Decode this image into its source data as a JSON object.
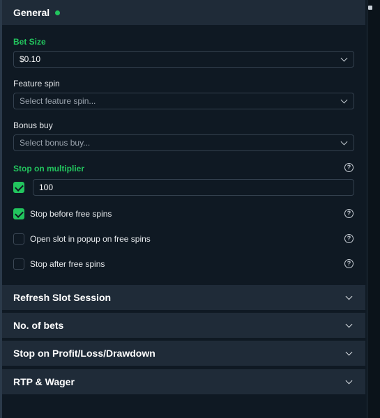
{
  "general": {
    "title": "General",
    "status_color": "#22c55e",
    "bet_size": {
      "label": "Bet Size",
      "value": "$0.10"
    },
    "feature_spin": {
      "label": "Feature spin",
      "placeholder": "Select feature spin..."
    },
    "bonus_buy": {
      "label": "Bonus buy",
      "placeholder": "Select bonus buy..."
    },
    "stop_on_multiplier": {
      "label": "Stop on multiplier",
      "checked": true,
      "value": "100"
    },
    "options": [
      {
        "label": "Stop before free spins",
        "checked": true
      },
      {
        "label": "Open slot in popup on free spins",
        "checked": false
      },
      {
        "label": "Stop after free spins",
        "checked": false
      }
    ]
  },
  "sections": [
    {
      "title": "Refresh Slot Session"
    },
    {
      "title": "No. of bets"
    },
    {
      "title": "Stop on Profit/Loss/Drawdown"
    },
    {
      "title": "RTP & Wager"
    }
  ],
  "icons": {
    "help": "help-circle-icon",
    "expand": "chevron-down-icon",
    "check": "checkmark-icon"
  },
  "colors": {
    "accent": "#22c55e",
    "panel": "#0f1923",
    "header": "#1f2b38"
  }
}
